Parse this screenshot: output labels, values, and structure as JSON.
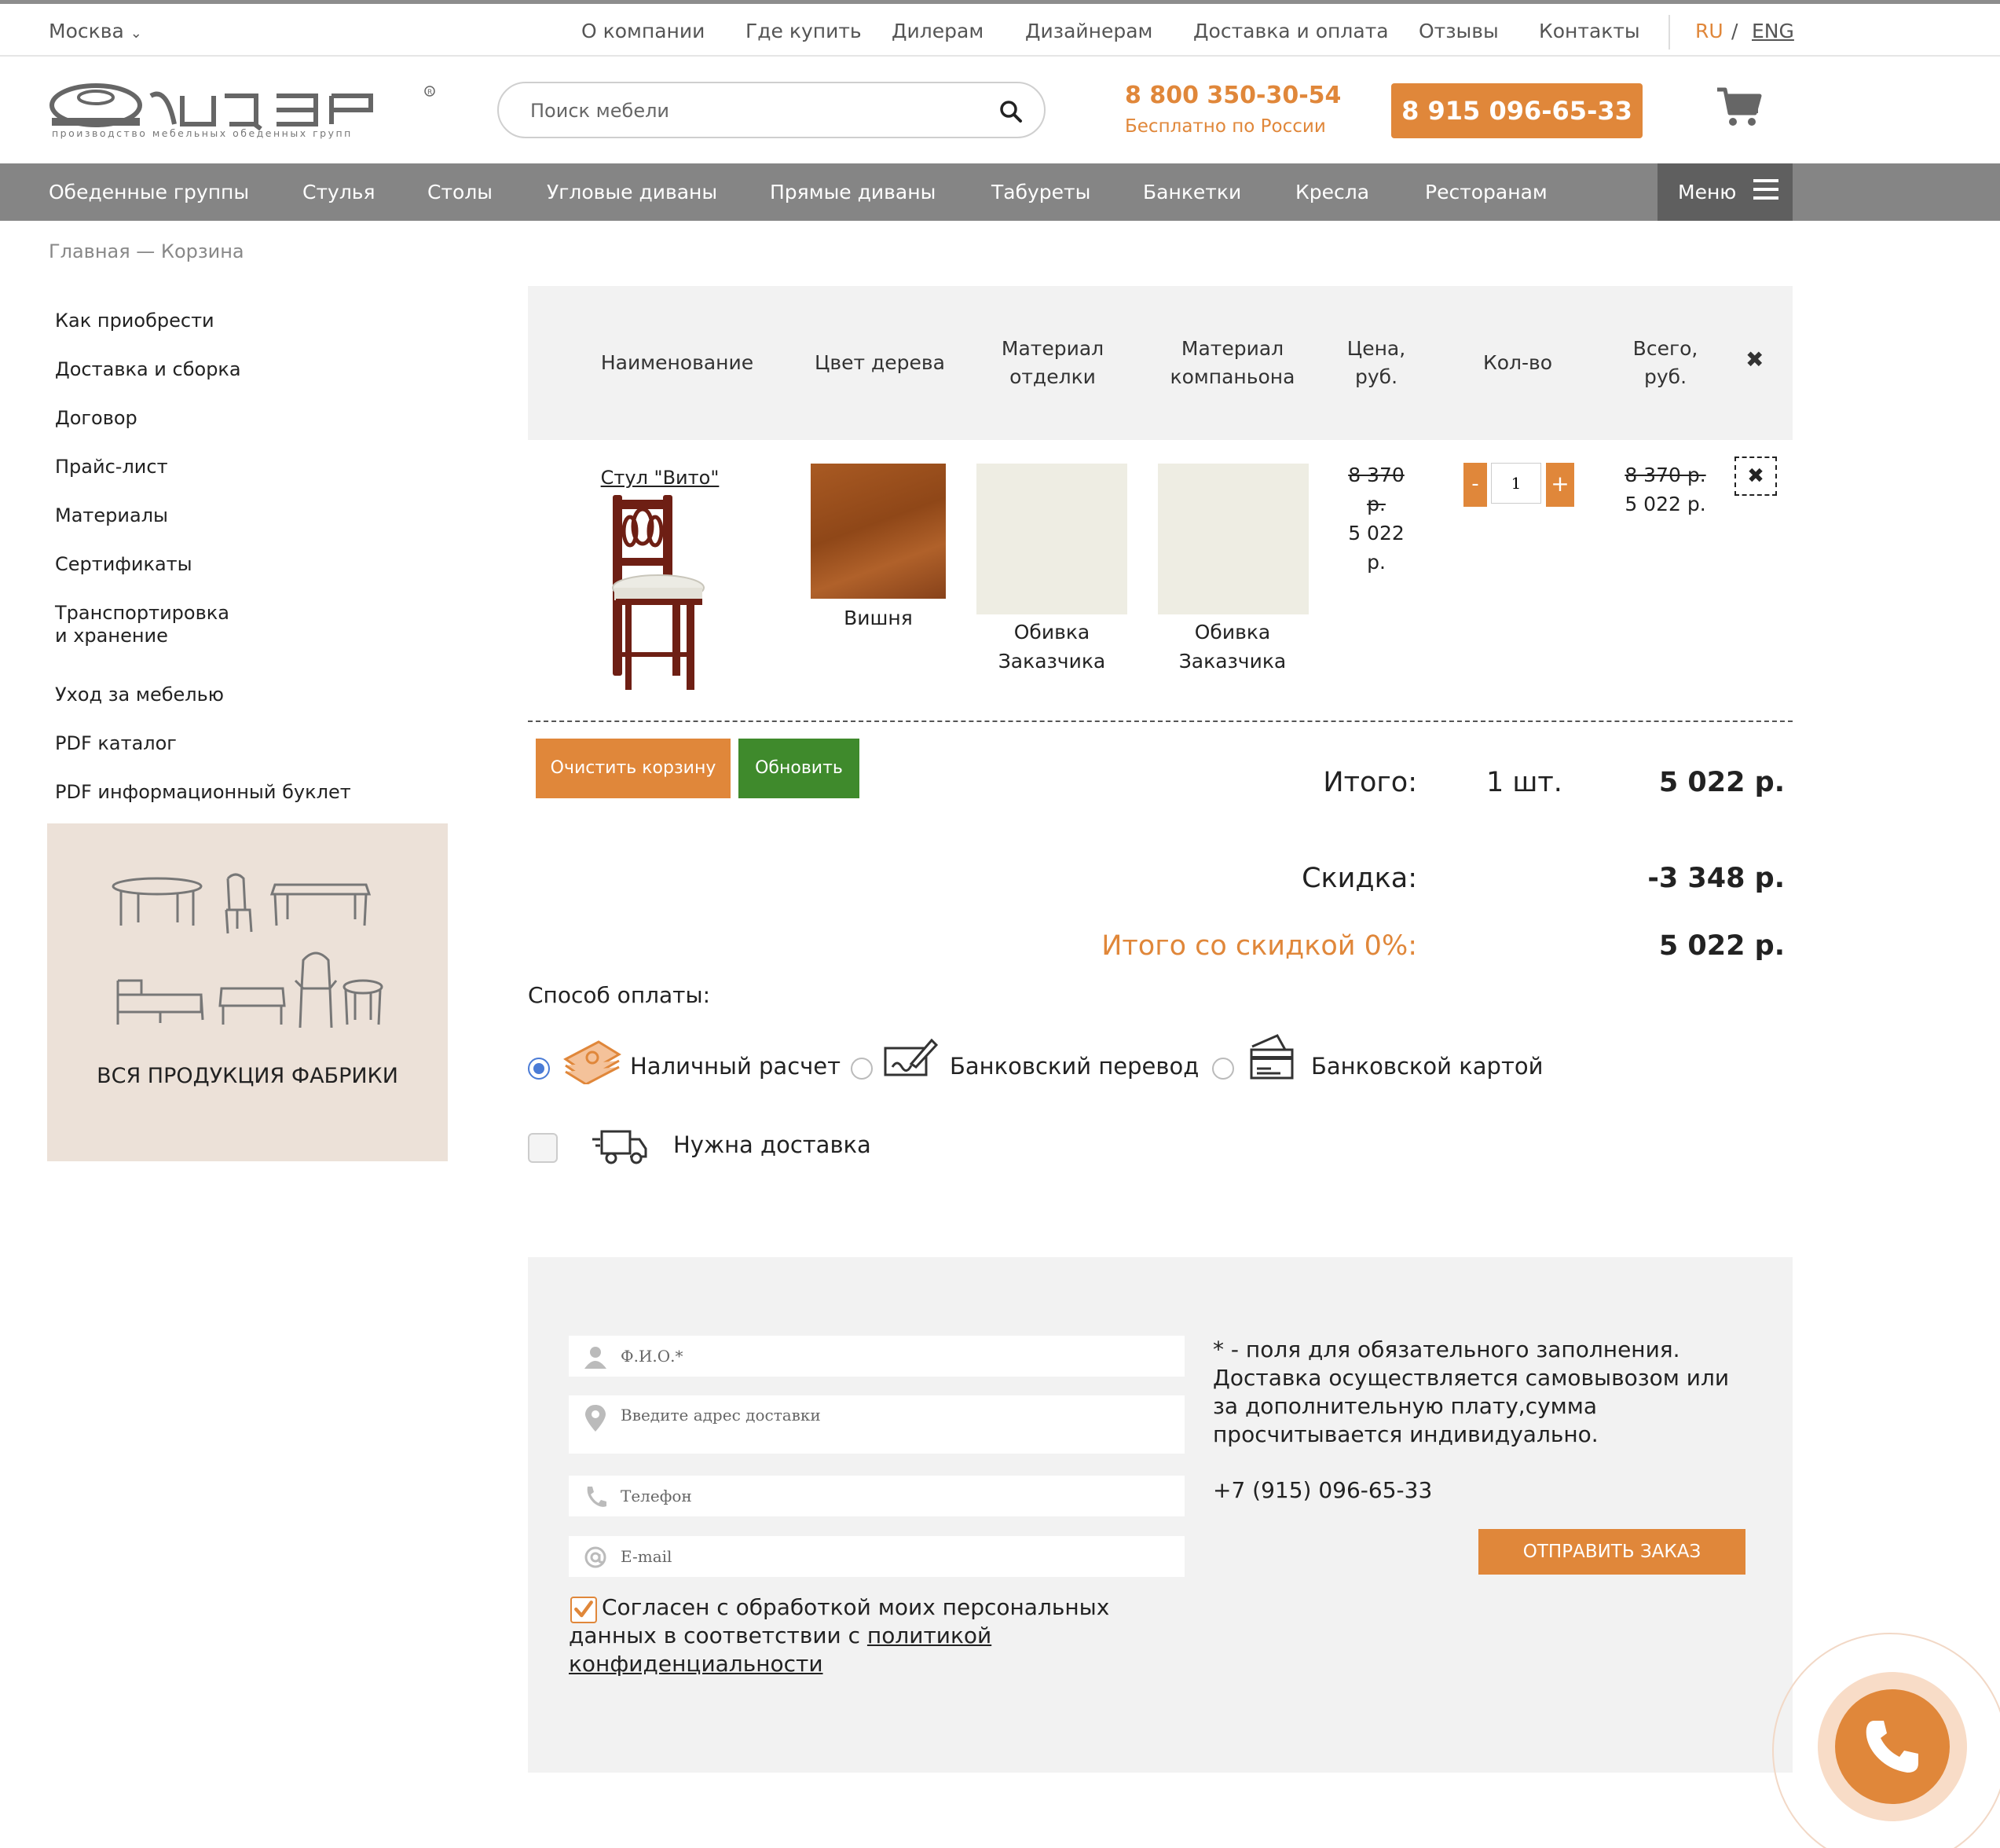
{
  "topbar": {
    "city": "Москва",
    "nav": [
      "О компании",
      "Где купить",
      "Дилерам",
      "Дизайнерам",
      "Доставка и оплата",
      "Отзывы",
      "Контакты"
    ],
    "lang_ru": "RU",
    "lang_slash": "/",
    "lang_en": "ENG"
  },
  "header": {
    "logo_text": "лидер",
    "logo_tagline": "производство мебельных обеденных групп",
    "search_placeholder": "Поиск мебели",
    "phone1": "8 800 350-30-54",
    "phone1_sub": "Бесплатно по России",
    "phone2": "8 915 096-65-33"
  },
  "menu": {
    "items": [
      "Обеденные группы",
      "Стулья",
      "Столы",
      "Угловые диваны",
      "Прямые диваны",
      "Табуреты",
      "Банкетки",
      "Кресла",
      "Ресторанам"
    ],
    "menu_label": "Меню"
  },
  "breadcrumb": "Главная — Корзина",
  "sidebar": {
    "links": [
      "Как приобрести",
      "Доставка и сборка",
      "Договор",
      "Прайс-лист",
      "Материалы",
      "Сертификаты",
      "Транспортировка",
      "и хранение",
      "Уход за мебелью",
      "PDF каталог",
      "PDF информационный буклет"
    ],
    "promo_label": "ВСЯ ПРОДУКЦИЯ ФАБРИКИ"
  },
  "cart": {
    "headers": {
      "name": "Наименование",
      "wood": "Цвет дерева",
      "finish_1": "Материал",
      "finish_2": "отделки",
      "companion_1": "Материал",
      "companion_2": "компаньона",
      "price_1": "Цена,",
      "price_2": "руб.",
      "qty": "Кол-во",
      "total_1": "Всего,",
      "total_2": "руб.",
      "remove": "✖"
    },
    "item": {
      "name": "Стул \"Вито\"",
      "wood": "Вишня",
      "finish_1": "Обивка",
      "finish_2": "Заказчика",
      "companion_1": "Обивка",
      "companion_2": "Заказчика",
      "price_old_1": "8 370",
      "price_old_2": "р.",
      "price_new_1": "5 022",
      "price_new_2": "р.",
      "qty": "1",
      "minus": "-",
      "plus": "+",
      "total_old": "8 370 р.",
      "total_new": "5 022 р.",
      "remove": "✖",
      "colors": {
        "wood": "#9a4e1d",
        "fabric": "#eeede3"
      }
    },
    "buttons": {
      "clear": "Очистить корзину",
      "update": "Обновить"
    },
    "summary": {
      "total_label": "Итого:",
      "count": "1 шт.",
      "total_value": "5 022 р.",
      "discount_label": "Скидка:",
      "discount_value": "-3 348 р.",
      "final_label": "Итого со скидкой 0%:",
      "final_value": "5 022 р."
    }
  },
  "payment": {
    "title": "Способ оплаты:",
    "options": [
      "Наличный расчет",
      "Банковский перевод",
      "Банковской картой"
    ],
    "selected": 0,
    "delivery_label": "Нужна доставка"
  },
  "form": {
    "fio_placeholder": "Ф.И.О.*",
    "address_placeholder": "Введите адрес доставки",
    "phone_placeholder": "Телефон",
    "email_placeholder": "E-mail",
    "note": "* - поля для обязательного заполнения. Доставка осуществляется самовывозом или за дополнительную плату,сумма просчитывается индивидуально.",
    "phone": "+7 (915) 096-65-33",
    "submit": "ОТПРАВИТЬ ЗАКАЗ",
    "agree_text": "Согласен с обработкой моих персональных данных в соответствии с ",
    "agree_link": "политикой конфиденциальности"
  },
  "colors": {
    "accent": "#e0873a",
    "green": "#3f8a2c",
    "menu_bg": "#858585",
    "panel_bg": "#f2f2f2"
  }
}
